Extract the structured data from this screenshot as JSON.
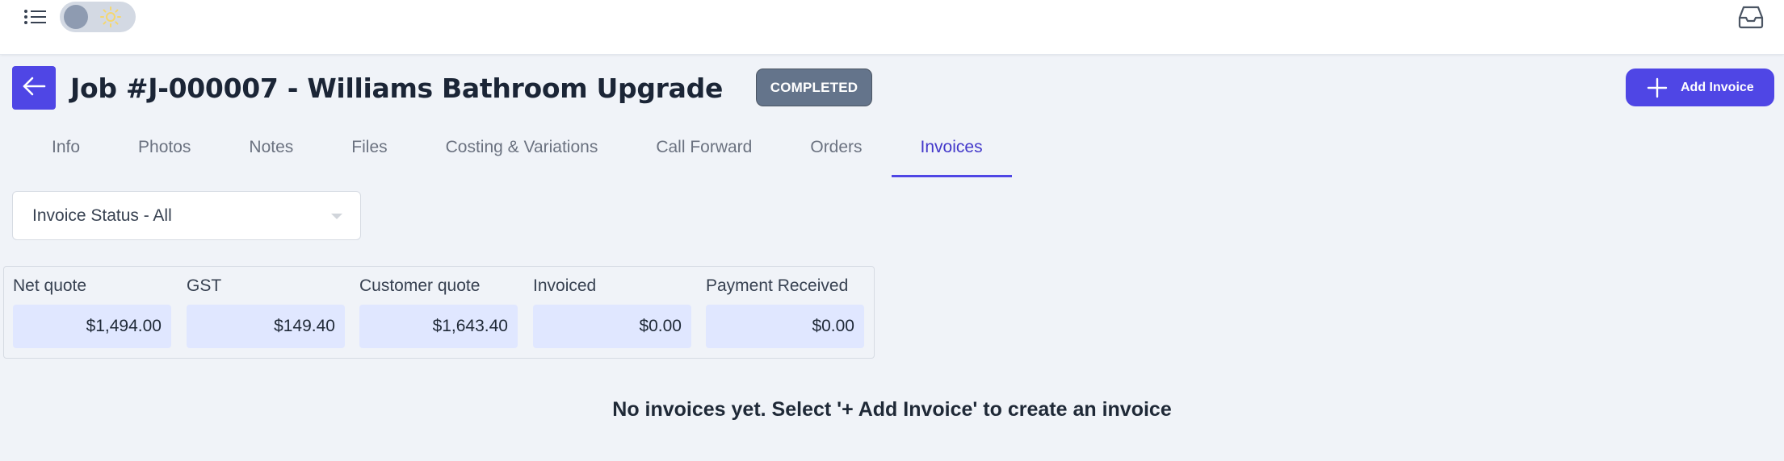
{
  "header": {
    "menu_icon": "list-icon",
    "theme_icon": "sun-icon",
    "inbox_icon": "inbox-icon"
  },
  "job": {
    "title": "Job #J-000007 - Williams Bathroom Upgrade",
    "status": "COMPLETED",
    "add_invoice_label": "Add Invoice",
    "accent_color": "#4f46e5",
    "status_color": "#64748b"
  },
  "tabs": [
    {
      "label": "Info"
    },
    {
      "label": "Photos"
    },
    {
      "label": "Notes"
    },
    {
      "label": "Files"
    },
    {
      "label": "Costing & Variations"
    },
    {
      "label": "Call Forward"
    },
    {
      "label": "Orders"
    },
    {
      "label": "Invoices",
      "active": true
    }
  ],
  "filter": {
    "status_value": "Invoice Status - All"
  },
  "summary": [
    {
      "label": "Net quote",
      "value": "$1,494.00"
    },
    {
      "label": "GST",
      "value": "$149.40"
    },
    {
      "label": "Customer quote",
      "value": "$1,643.40"
    },
    {
      "label": "Invoiced",
      "value": "$0.00"
    },
    {
      "label": "Payment Received",
      "value": "$0.00"
    }
  ],
  "empty_state": {
    "message": "No invoices yet. Select '+ Add Invoice' to create an invoice"
  }
}
